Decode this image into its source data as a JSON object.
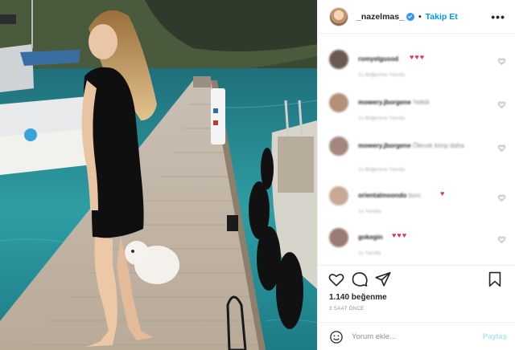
{
  "post": {
    "username": "_nazelmas_",
    "separator": "•",
    "follow_label": "Takip Et",
    "more_label": "•••",
    "likes": "1.140 beğenme",
    "time": "3 SAAT ÖNCE"
  },
  "comments": [
    {
      "user": "romyelgusod",
      "text": "",
      "reaction": "♥♥♥",
      "meta": "1s   Beğenme   Yanıtla"
    },
    {
      "user": "mowery.jborgene",
      "text": "Yetkili",
      "reaction": "",
      "meta": "1s   Beğenme   Yanıtla"
    },
    {
      "user": "mowery.jborgene",
      "text": "Ölecek kimp daha",
      "reaction": "",
      "meta": "1s   Beğenme   Yanıtla"
    },
    {
      "user": "orientalmoondo",
      "text": "burc",
      "reaction": "♥",
      "meta": "1s   Yanıtla"
    },
    {
      "user": "gokegin",
      "text": "",
      "reaction": "♥♥♥",
      "meta": "1s   Yanıtla"
    }
  ],
  "compose": {
    "placeholder": "Yorum ekle...",
    "share_label": "Paylaş"
  },
  "icons": {
    "like": "heart-icon",
    "comment": "comment-bubble-icon",
    "share": "paper-plane-icon",
    "save": "bookmark-icon",
    "emoji": "smiley-icon",
    "verified": "verified-badge-icon",
    "more": "more-options-icon"
  },
  "colors": {
    "accent": "#0095f6",
    "verified": "#3897f0",
    "reaction": "#e0384f",
    "text": "#262626",
    "muted": "#8e8e8e"
  }
}
